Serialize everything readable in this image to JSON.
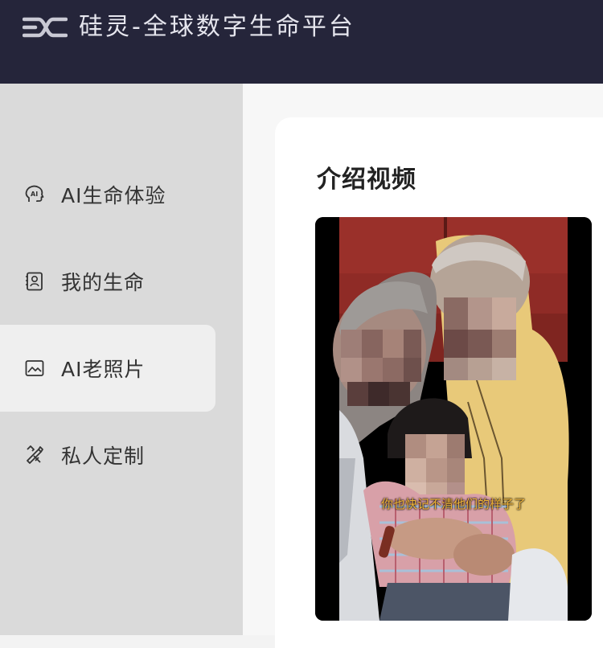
{
  "header": {
    "title": "硅灵-全球数字生命平台",
    "logo_icon": "brand-logo-icon"
  },
  "sidebar": {
    "items": [
      {
        "label": "AI生命体验",
        "icon": "ai-head-icon",
        "active": false
      },
      {
        "label": "我的生命",
        "icon": "profile-card-icon",
        "active": false
      },
      {
        "label": "AI老照片",
        "icon": "image-icon",
        "active": true
      },
      {
        "label": "私人定制",
        "icon": "tools-icon",
        "active": false
      }
    ]
  },
  "main": {
    "section_title": "介绍视频",
    "video": {
      "subtitle": "你也快记不清他们的样子了"
    }
  },
  "colors": {
    "header_bg": "#25253a",
    "sidebar_bg": "#dadada",
    "active_item_bg": "#efefef",
    "subtitle_color": "#f0b43a"
  }
}
